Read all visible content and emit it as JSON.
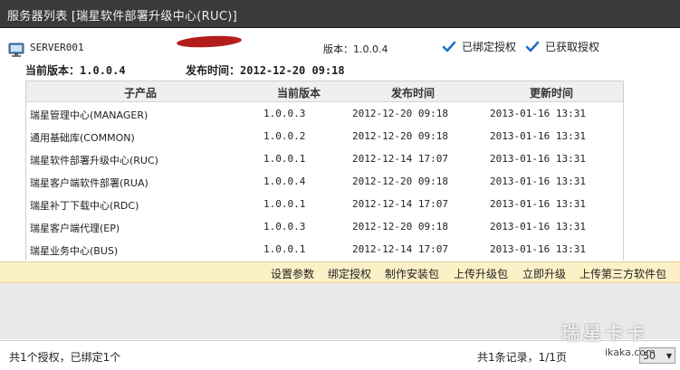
{
  "window": {
    "title": "服务器列表 [瑞星软件部署升级中心(RUC)]"
  },
  "server": {
    "name": "SERVER001",
    "version_label": "版本：1.0.0.4",
    "badges": [
      "已绑定授权",
      "已获取授权"
    ],
    "current_version_label": "当前版本：",
    "current_version": "1.0.0.4",
    "publish_time_label": "发布时间：",
    "publish_time": "2012-12-20 09:18"
  },
  "table": {
    "headers": [
      "子产品",
      "当前版本",
      "发布时间",
      "更新时间"
    ],
    "rows": [
      {
        "name": "瑞星管理中心(MANAGER)",
        "version": "1.0.0.3",
        "published": "2012-12-20 09:18",
        "updated": "2013-01-16 13:31"
      },
      {
        "name": "通用基础库(COMMON)",
        "version": "1.0.0.2",
        "published": "2012-12-20 09:18",
        "updated": "2013-01-16 13:31"
      },
      {
        "name": "瑞星软件部署升级中心(RUC)",
        "version": "1.0.0.1",
        "published": "2012-12-14 17:07",
        "updated": "2013-01-16 13:31"
      },
      {
        "name": "瑞星客户端软件部署(RUA)",
        "version": "1.0.0.4",
        "published": "2012-12-20 09:18",
        "updated": "2013-01-16 13:31"
      },
      {
        "name": "瑞星补丁下载中心(RDC)",
        "version": "1.0.0.1",
        "published": "2012-12-14 17:07",
        "updated": "2013-01-16 13:31"
      },
      {
        "name": "瑞星客户端代理(EP)",
        "version": "1.0.0.3",
        "published": "2012-12-20 09:18",
        "updated": "2013-01-16 13:31"
      },
      {
        "name": "瑞星业务中心(BUS)",
        "version": "1.0.0.1",
        "published": "2012-12-14 17:07",
        "updated": "2013-01-16 13:31"
      }
    ]
  },
  "actions": [
    "设置参数",
    "绑定授权",
    "制作安装包",
    "上传升级包",
    "立即升级",
    "上传第三方软件包"
  ],
  "footer": {
    "left": "共1个授权，已绑定1个",
    "right": "共1条记录，1/1页",
    "page_size": "50"
  },
  "watermark": {
    "text": "瑞星卡卡",
    "sub": "ikaka.com"
  },
  "colors": {
    "check": "#1a6fc4",
    "action_bar": "#fcf0c6",
    "titlebar": "#3a3a3a"
  }
}
